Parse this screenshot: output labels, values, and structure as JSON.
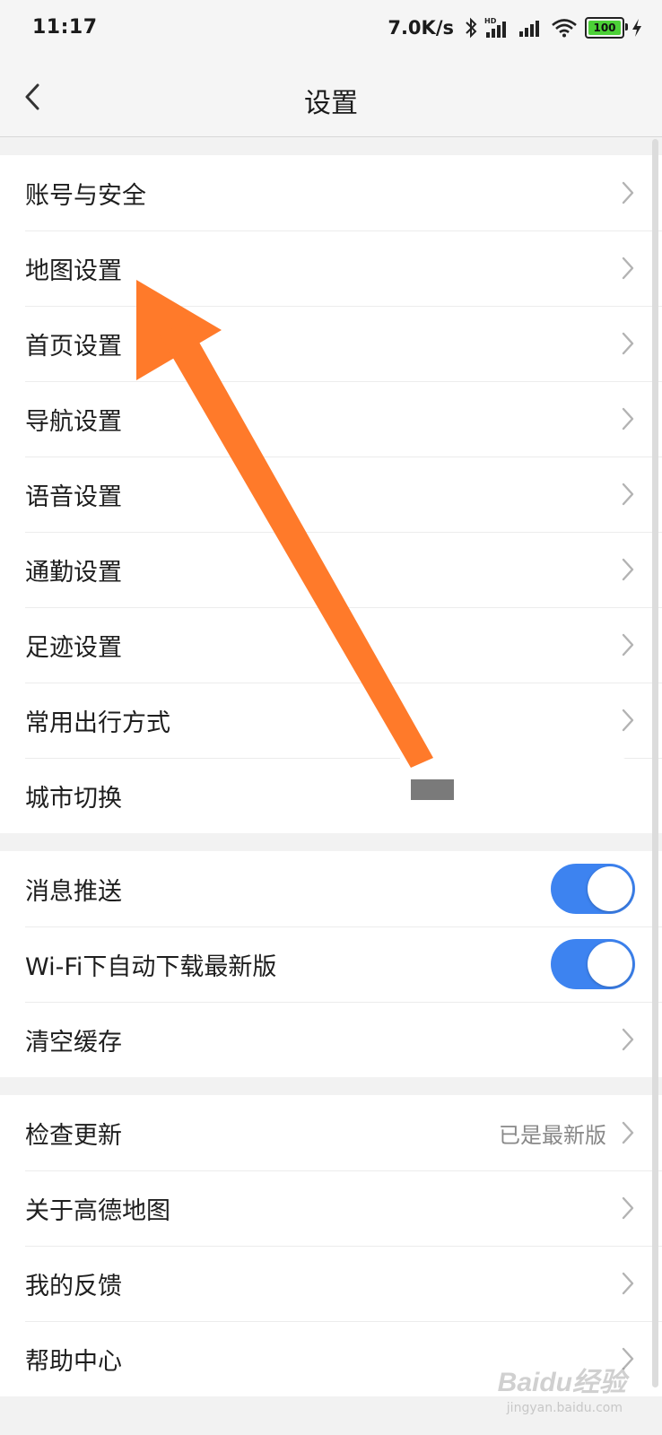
{
  "status_bar": {
    "time": "11:17",
    "net_speed": "7.0K/s",
    "battery": "100",
    "icons": [
      "bluetooth-icon",
      "hd-signal-icon",
      "signal-icon",
      "wifi-icon",
      "battery-icon",
      "charging-icon"
    ]
  },
  "header": {
    "title": "设置",
    "back_icon": "back-chevron-icon"
  },
  "groups": {
    "main": [
      {
        "label": "账号与安全"
      },
      {
        "label": "地图设置"
      },
      {
        "label": "首页设置"
      },
      {
        "label": "导航设置"
      },
      {
        "label": "语音设置"
      },
      {
        "label": "通勤设置"
      },
      {
        "label": "足迹设置"
      },
      {
        "label": "常用出行方式"
      },
      {
        "label": "城市切换"
      }
    ],
    "toggles": [
      {
        "label": "消息推送",
        "on": true
      },
      {
        "label": "Wi-Fi下自动下载最新版",
        "on": true
      },
      {
        "label": "清空缓存"
      }
    ],
    "about": [
      {
        "label": "检查更新",
        "value": "已是最新版"
      },
      {
        "label": "关于高德地图"
      },
      {
        "label": "我的反馈"
      },
      {
        "label": "帮助中心"
      }
    ]
  },
  "colors": {
    "toggle_on": "#3d83f0",
    "annotation_arrow": "#ff7a2a"
  },
  "watermark": {
    "text": "Baidu经验",
    "sub": "jingyan.baidu.com"
  }
}
